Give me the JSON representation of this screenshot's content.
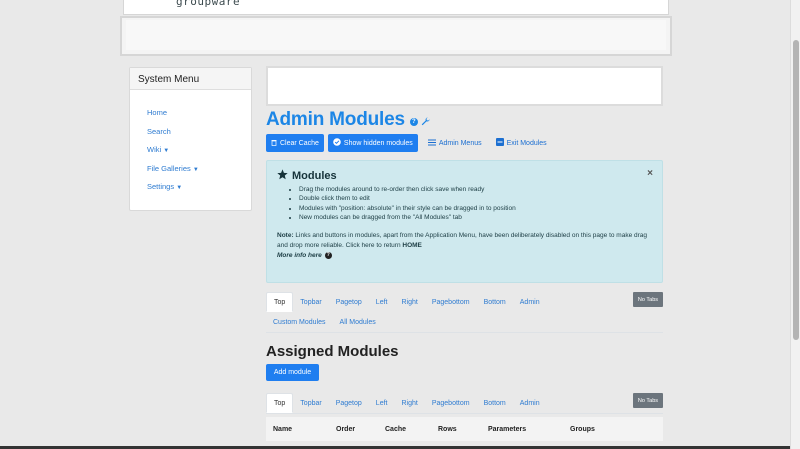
{
  "header": {
    "logo_text": "groupware"
  },
  "system_menu": {
    "title": "System Menu",
    "items": [
      {
        "label": "Home",
        "has_caret": false
      },
      {
        "label": "Search",
        "has_caret": false
      },
      {
        "label": "Wiki",
        "has_caret": true
      },
      {
        "label": "File Galleries",
        "has_caret": true
      },
      {
        "label": "Settings",
        "has_caret": true
      }
    ]
  },
  "page": {
    "title": "Admin Modules",
    "help_icon": "question-circle-icon",
    "wrench_icon": "wrench-icon"
  },
  "toolbar": {
    "clear_cache": "Clear Cache",
    "show_hidden": "Show hidden modules",
    "admin_menus": "Admin Menus",
    "exit_modules": "Exit Modules"
  },
  "alert": {
    "title": "Modules",
    "close": "×",
    "bullets": [
      "Drag the modules around to re-order then click save when ready",
      "Double click them to edit",
      "Modules with \"position: absolute\" in their style can be dragged in to position",
      "New modules can be dragged from the \"All Modules\" tab"
    ],
    "note_label": "Note:",
    "note_text": " Links and buttons in modules, apart from the Application Menu, have been deliberately disabled on this page to make drag and drop more reliable. Click here to return ",
    "note_home": "HOME",
    "more_info": "More info here"
  },
  "tabs_top": {
    "no_tabs": "No Tabs",
    "items": [
      "Top",
      "Topbar",
      "Pagetop",
      "Left",
      "Right",
      "Pagebottom",
      "Bottom",
      "Admin",
      "Custom Modules",
      "All Modules"
    ]
  },
  "assigned": {
    "title": "Assigned Modules",
    "add_button": "Add module"
  },
  "tabs_assigned": {
    "no_tabs": "No Tabs",
    "items": [
      "Top",
      "Topbar",
      "Pagetop",
      "Left",
      "Right",
      "Pagebottom",
      "Bottom",
      "Admin"
    ]
  },
  "table": {
    "columns": [
      "Name",
      "Order",
      "Cache",
      "Rows",
      "Parameters",
      "Groups"
    ]
  },
  "colors": {
    "primary": "#1f7ef0",
    "link": "#2f7cd1",
    "alert_bg": "#cfe9ee",
    "no_tabs_bg": "#6c757d"
  }
}
